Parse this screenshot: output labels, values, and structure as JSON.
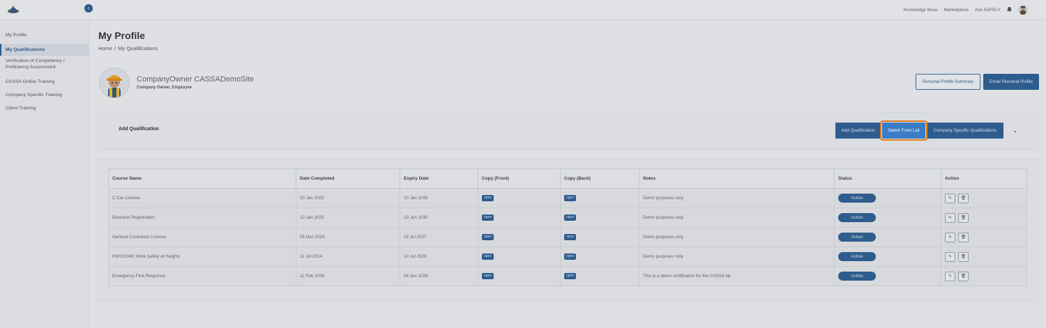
{
  "topbar": {
    "links": [
      "Knowledge Base",
      "Marketplace",
      "Ask SAFELY"
    ]
  },
  "sidebar": {
    "items": [
      {
        "label": "My Profile"
      },
      {
        "label": "My Qualifications"
      },
      {
        "label": "Verification of Competency / Proficiency Assessment"
      },
      {
        "label": "CASSA Online Training"
      },
      {
        "label": "Company Specific Training"
      },
      {
        "label": "Client Training"
      }
    ],
    "active_index": 1
  },
  "header": {
    "title": "My Profile",
    "breadcrumb": [
      "Home",
      "My Qualifications"
    ],
    "separator": "/"
  },
  "profile": {
    "name": "CompanyOwner CASSADemoSite",
    "role": "Company Owner, Employee",
    "summary_button": "Personal Profile Summary",
    "email_button": "Email Personal Profile"
  },
  "qualification_bar": {
    "label": "Add Qualification",
    "buttons": [
      "Add Qualification",
      "Select From List",
      "Company Specific Qualifications"
    ],
    "highlighted_index": 1
  },
  "table": {
    "columns": [
      "Course Name",
      "Date Completed",
      "Expiry Date",
      "Copy (Front)",
      "Copy (Back)",
      "Notes",
      "Status",
      "Action"
    ],
    "rows": [
      {
        "course": "C Car License",
        "completed": "20 Jan 2025",
        "expiry": "10 Jan 2035",
        "front": "open",
        "back": "open",
        "notes": "Demo purposes only.",
        "status": "Active"
      },
      {
        "course": "Business Registration",
        "completed": "12 Jan 2025",
        "expiry": "19 Jun 2030",
        "front": "open",
        "back": "open",
        "notes": "Demo purposes only.",
        "status": "Active"
      },
      {
        "course": "General Contractor License",
        "completed": "05 Dec 2024",
        "expiry": "18 Jul 2027",
        "front": "open",
        "back": "open",
        "notes": "Demo purposes only.",
        "status": "Active"
      },
      {
        "course": "RIIHS204D Work Safely at Heights",
        "completed": "11 Jul 2024",
        "expiry": "10 Jul 2026",
        "front": "open",
        "back": "open",
        "notes": "Demo purposes only.",
        "status": "Active"
      },
      {
        "course": "Emergency First Response",
        "completed": "11 Feb 2026",
        "expiry": "06 Jun 2028",
        "front": "open",
        "back": "open",
        "notes": "This is a demo certification for the CASSA kb.",
        "status": "Active"
      }
    ]
  },
  "colors": {
    "primary": "#2d5f93",
    "highlight_outline": "#e07b1a"
  }
}
